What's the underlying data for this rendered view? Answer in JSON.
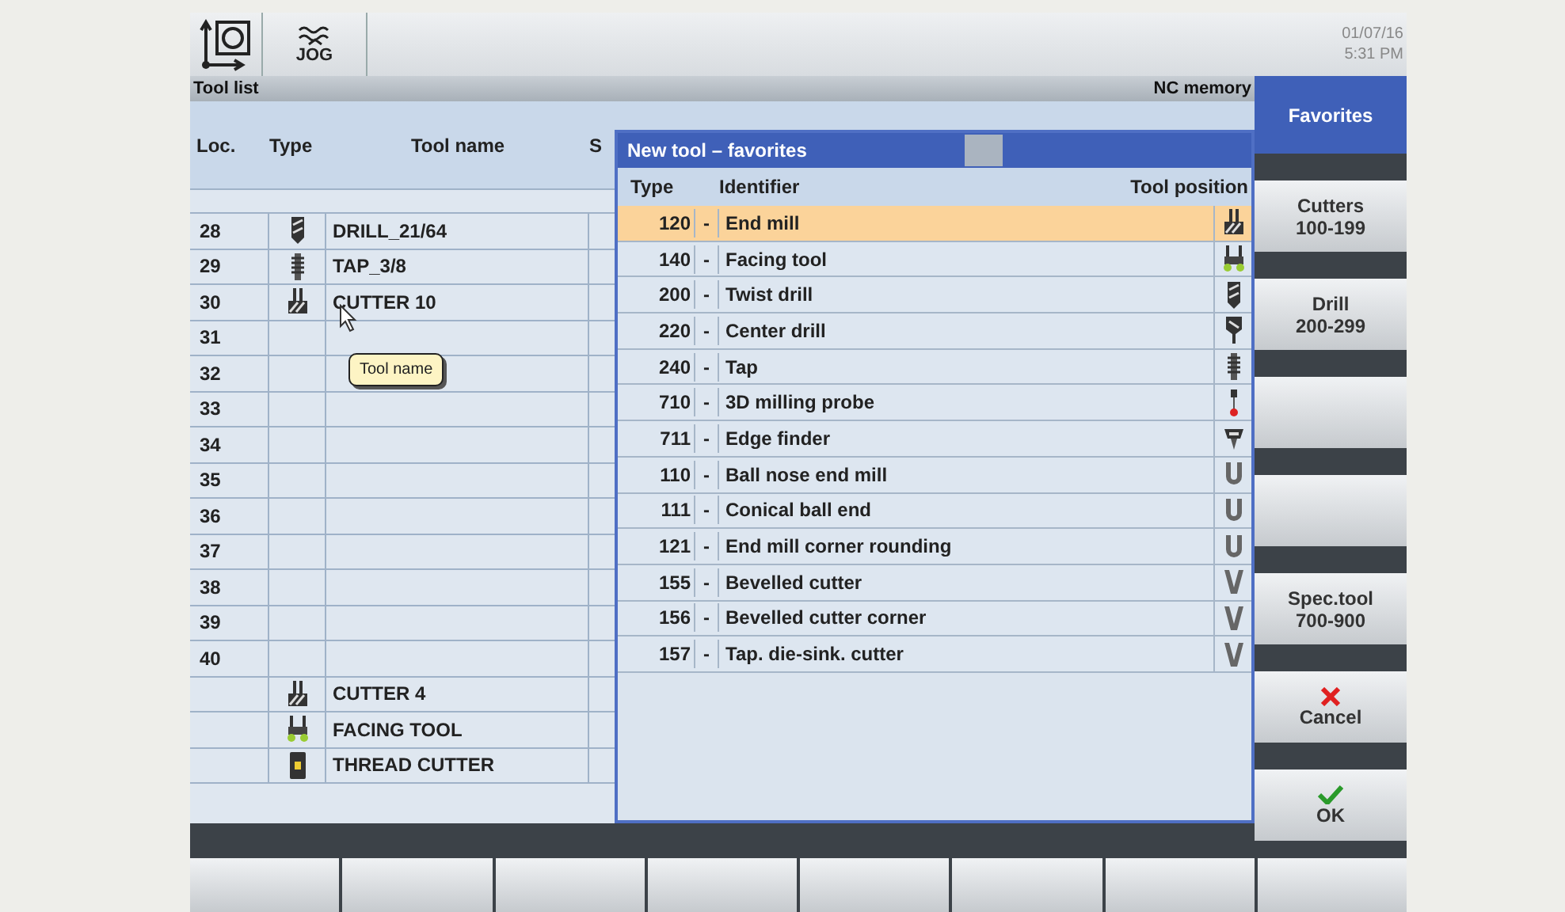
{
  "top_bar": {
    "mode_label": "JOG",
    "date": "01/07/16",
    "time": "5:31 PM"
  },
  "header": {
    "title": "Tool list",
    "memory": "NC memory"
  },
  "tool_list": {
    "columns": [
      "Loc.",
      "Type",
      "Tool name",
      "S"
    ],
    "rows": [
      {
        "loc": "28",
        "kind": "drill",
        "name": "DRILL_21/64"
      },
      {
        "loc": "29",
        "kind": "tap",
        "name": "TAP_3/8"
      },
      {
        "loc": "30",
        "kind": "end_mill",
        "name": "CUTTER 10"
      },
      {
        "loc": "31"
      },
      {
        "loc": "32"
      },
      {
        "loc": "33"
      },
      {
        "loc": "34"
      },
      {
        "loc": "35"
      },
      {
        "loc": "36"
      },
      {
        "loc": "37"
      },
      {
        "loc": "38"
      },
      {
        "loc": "39"
      },
      {
        "loc": "40"
      },
      {
        "kind": "end_mill",
        "name": "CUTTER 4"
      },
      {
        "kind": "facing_tool",
        "name": "FACING TOOL"
      },
      {
        "kind": "thread_cutter",
        "name": "THREAD CUTTER"
      }
    ],
    "tooltip": "Tool name"
  },
  "dialog": {
    "title": "New tool – favorites",
    "columns": [
      "Type",
      "Identifier",
      "Tool position"
    ],
    "rows": [
      {
        "type": "120",
        "separator": "-",
        "identifier": "End mill",
        "kind": "end_mill",
        "selected": true
      },
      {
        "type": "140",
        "separator": "-",
        "identifier": "Facing tool",
        "kind": "facing_tool",
        "selected": false
      },
      {
        "type": "200",
        "separator": "-",
        "identifier": "Twist drill",
        "kind": "drill",
        "selected": false
      },
      {
        "type": "220",
        "separator": "-",
        "identifier": "Center drill",
        "kind": "center_drill",
        "selected": false
      },
      {
        "type": "240",
        "separator": "-",
        "identifier": "Tap",
        "kind": "tap",
        "selected": false
      },
      {
        "type": "710",
        "separator": "-",
        "identifier": "3D milling probe",
        "kind": "probe",
        "selected": false
      },
      {
        "type": "711",
        "separator": "-",
        "identifier": "Edge finder",
        "kind": "edge_finder",
        "selected": false
      },
      {
        "type": "110",
        "separator": "-",
        "identifier": "Ball nose end mill",
        "kind": "ball_nose",
        "selected": false
      },
      {
        "type": "111",
        "separator": "-",
        "identifier": "Conical ball end",
        "kind": "ball_nose",
        "selected": false
      },
      {
        "type": "121",
        "separator": "-",
        "identifier": "End mill corner rounding",
        "kind": "ball_nose",
        "selected": false
      },
      {
        "type": "155",
        "separator": "-",
        "identifier": "Bevelled cutter",
        "kind": "bevel",
        "selected": false
      },
      {
        "type": "156",
        "separator": "-",
        "identifier": "Bevelled cutter corner",
        "kind": "bevel",
        "selected": false
      },
      {
        "type": "157",
        "separator": "-",
        "identifier": "Tap. die-sink. cutter",
        "kind": "bevel",
        "selected": false
      }
    ]
  },
  "softkeys": [
    {
      "kind": "text",
      "lines": [
        "Favorites"
      ],
      "selected": true
    },
    {
      "kind": "text",
      "lines": [
        "Cutters",
        "100-199"
      ],
      "selected": false
    },
    {
      "kind": "text",
      "lines": [
        "Drill",
        "200-299"
      ],
      "selected": false
    },
    {
      "kind": "blank",
      "selected": false
    },
    {
      "kind": "blank",
      "selected": false
    },
    {
      "kind": "text",
      "lines": [
        "Spec.tool",
        "700-900"
      ],
      "selected": false
    },
    {
      "kind": "cancel",
      "lines": [
        "Cancel"
      ],
      "selected": false
    },
    {
      "kind": "ok",
      "lines": [
        "OK"
      ],
      "selected": false
    }
  ]
}
